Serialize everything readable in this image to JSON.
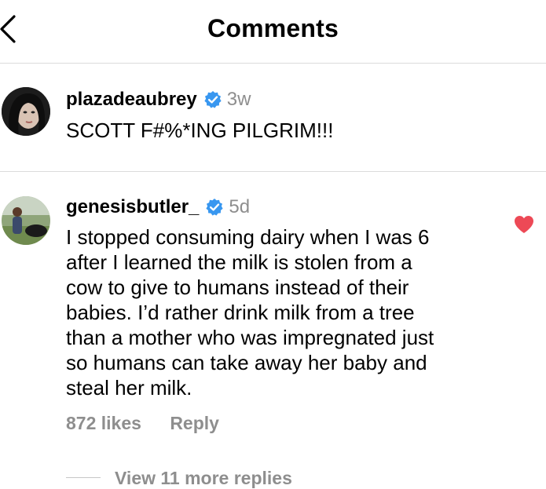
{
  "header": {
    "title": "Comments"
  },
  "comments": [
    {
      "username": "plazadeaubrey",
      "verified": true,
      "time": "3w",
      "text": "SCOTT F#%*ING PILGRIM!!!"
    },
    {
      "username": "genesisbutler_",
      "verified": true,
      "time": "5d",
      "text_lines": [
        "I stopped consuming dairy when I was 6",
        "after I learned the milk is stolen from a",
        "cow to give to humans instead of their",
        "babies. I’d rather drink milk from a tree",
        "than a mother who was impregnated just",
        "so humans can take away her baby and",
        "steal her milk."
      ],
      "likes": "872 likes",
      "reply_label": "Reply",
      "liked": true,
      "more_replies": "View 11 more replies"
    }
  ],
  "colors": {
    "verified": "#3897f0",
    "heart": "#ed4956",
    "muted": "#8e8e8e",
    "divider": "#dbdbdb"
  }
}
